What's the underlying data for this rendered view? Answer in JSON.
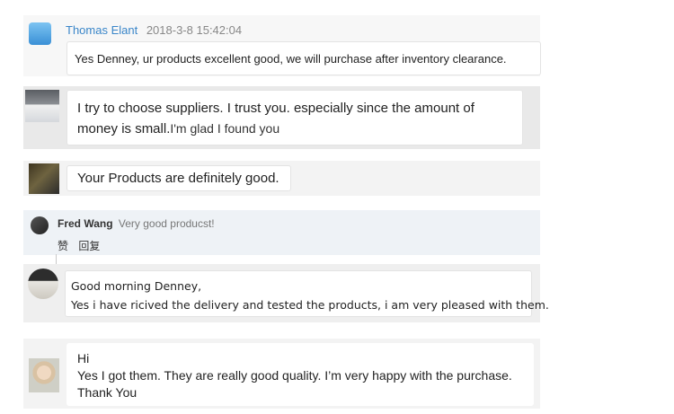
{
  "comments": [
    {
      "author": "Thomas Elant",
      "time": "2018-3-8 15:42:04",
      "text": "Yes Denney, ur products excellent good, we will purchase after inventory clearance."
    },
    {
      "text": "I try to choose suppliers. I trust you. especially since the amount of money is small.",
      "text_small": "I'm glad I found you"
    },
    {
      "text": "Your Products are definitely good."
    },
    {
      "author": "Fred Wang",
      "text": "Very good producst!",
      "actions": [
        "赞",
        "回复"
      ]
    },
    {
      "lines": [
        "Good morning Denney,",
        "Yes i have ricived the delivery and tested the products, i am very pleased with them."
      ]
    },
    {
      "lines": [
        "Hi",
        "Yes I got them. They are really good quality. I’m very happy with the purchase.",
        "Thank You"
      ]
    }
  ]
}
